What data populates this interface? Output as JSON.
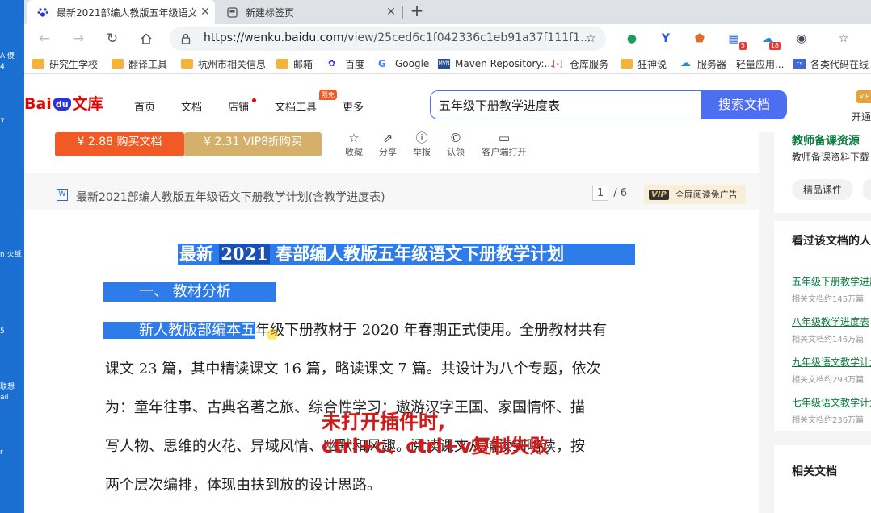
{
  "desktop": {
    "fragments": [
      "A 傻",
      "4",
      "7",
      "n 火纸",
      "5",
      "联想",
      "ail",
      "r"
    ]
  },
  "tabs": [
    {
      "title": "最新2021部编人教版五年级语文",
      "active": true
    },
    {
      "title": "新建标签页",
      "active": false
    }
  ],
  "toolbar": {
    "url_host": "https://wenku.baidu.com",
    "url_path": "/view/25ced6c1f042336c1eb91a37f111f1...",
    "ext_badge_1": "5",
    "ext_badge_2": "18"
  },
  "bookmarks": [
    "研究生学校",
    "翻译工具",
    "杭州市相关信息",
    "邮箱",
    "百度",
    "Google",
    "Maven Repository:...",
    "仓库服务",
    "狂神说",
    "服务器 - 轻量应用...",
    "各类代码在线"
  ],
  "header": {
    "logo_bai": "Bai",
    "logo_du": "du",
    "logo_wenku": "文库",
    "nav": [
      "首页",
      "文档",
      "店铺",
      "文档工具",
      "更多"
    ],
    "tool_tag": "限免",
    "search_value": "五年级下册教学进度表",
    "search_button": "搜索文档",
    "vip_icon": "VIP",
    "vip_text": "开通"
  },
  "buybar": {
    "buy_label": "¥ 2.88 购买文档",
    "vip_buy_label": "¥ 2.31 VIP8折购买",
    "actions": [
      "收藏",
      "分享",
      "举报",
      "认领",
      "客户端打开"
    ]
  },
  "docbar": {
    "icon": "W",
    "title": "最新2021部编人教版五年级语文下册教学计划(含教学进度表)",
    "page_current": "1",
    "page_total": "/ 6",
    "vip_badge": "VIP",
    "vip_label": "全屏阅读免广告"
  },
  "document": {
    "title_a": "最新 ",
    "title_b": "2021",
    "title_c": " 春部编人教版五年级语文下册教学计划",
    "section": "一、 教材分析",
    "p1_selected": "新人教版部编本五",
    "p1_rest": "年级下册教材于 2020 年春期正式使用。全册教材共有",
    "p2": "课文 23 篇，其中精读课文 16 篇，略读课文 7 篇。共设计为八个专题，依次",
    "p3": "为：童年往事、古典名著之旅、综合性学习：遨游汉字王国、家国情怀、描",
    "p4": "写人物、思维的火花、异域风情、幽默和风趣。阅读课文从精读到略读，按",
    "p5": "两个层次编排，体现由扶到放的设计思路。",
    "overlay_1": "未打开插件时,",
    "overlay_2": "ctrl+c、ctrl+v复制失败"
  },
  "sidebar": {
    "promo_title": "教师备课资源",
    "promo_sub": "教师备课资料下载",
    "chip": "精品课件",
    "viewed_title": "看过该文档的人",
    "viewed": [
      {
        "title": "五年级下册教学进度",
        "sub": "相关文档约145万篇"
      },
      {
        "title": "八年级教学进度表",
        "sub": "相关文档约146万篇"
      },
      {
        "title": "九年级语文教学计划",
        "sub": "相关文档约293万篇"
      },
      {
        "title": "七年级语文教学计划",
        "sub": "相关文档约236万篇"
      }
    ],
    "related_title": "相关文档"
  }
}
